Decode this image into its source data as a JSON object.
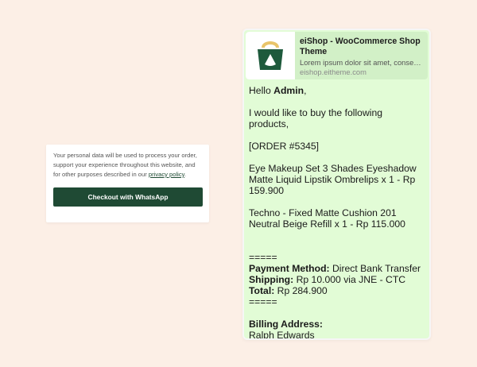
{
  "checkout": {
    "privacy_text": "Your personal data will be used to process your order, support your experience throughout this website, and for other purposes described in our ",
    "privacy_link": "privacy policy",
    "privacy_end": ".",
    "button_label": "Checkout with WhatsApp"
  },
  "chat": {
    "preview": {
      "title": "eiShop - WooCommerce Shop Theme",
      "description": "Lorem ipsum dolor sit amet, consectetur",
      "domain": "eishop.eitheme.com",
      "logo_icon": "shopping-bag-logo-icon",
      "logo_color": "#1e5a3c",
      "logo_accent": "#e9c46a"
    },
    "greeting_prefix": "Hello ",
    "greeting_name": "Admin",
    "greeting_suffix": ",",
    "intro_line1": "I would like to buy the following",
    "intro_line2": "products,",
    "order_id": "[ORDER #5345]",
    "item1_line1": "Eye Makeup Set 3 Shades Eyeshadow",
    "item1_line2": "Matte Liquid Lipstik Ombrelips x 1 - Rp",
    "item1_line3": "159.900",
    "item2_line1": "Techno - Fixed Matte Cushion 201",
    "item2_line2": "Neutral Beige Refill x 1 - Rp 115.000",
    "separator": "=====",
    "payment_label": "Payment Method:",
    "payment_value": " Direct Bank Transfer",
    "shipping_label": "Shipping:",
    "shipping_value": " Rp 10.000 via JNE - CTC",
    "total_label": "Total:",
    "total_value": " Rp 284.900",
    "separator2": "=====",
    "billing_label": "Billing Address:",
    "billing_name": "Ralph Edwards"
  },
  "colors": {
    "background": "#fcefe6",
    "button": "#1f4a34",
    "bubble": "#e2fcd6",
    "preview": "#d2f0c7"
  }
}
